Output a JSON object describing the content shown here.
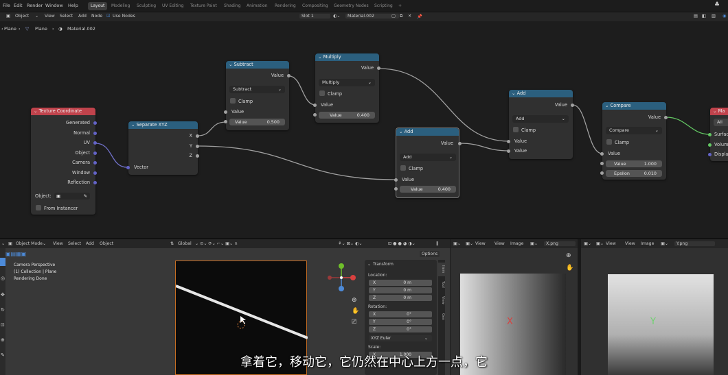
{
  "topbar": {
    "menus": [
      "File",
      "Edit",
      "Render",
      "Window",
      "Help"
    ],
    "tabs": [
      "Layout",
      "Modeling",
      "Sculpting",
      "UV Editing",
      "Texture Paint",
      "Shading",
      "Animation",
      "Rendering",
      "Compositing",
      "Geometry Nodes",
      "Scripting",
      "+"
    ]
  },
  "node_header": {
    "object_mode": "Object",
    "view": "View",
    "select": "Select",
    "add": "Add",
    "node": "Node",
    "use_nodes": "Use Nodes",
    "slot": "Slot 1",
    "material": "Material.002"
  },
  "breadcrumb": {
    "plane1": "Plane",
    "plane2": "Plane",
    "material": "Material.002"
  },
  "nodes": {
    "texcoord": {
      "title": "Texture Coordinate",
      "outputs": [
        "Generated",
        "Normal",
        "UV",
        "Object",
        "Camera",
        "Window",
        "Reflection"
      ],
      "object_label": "Object:",
      "from_instancer": "From Instancer"
    },
    "separate": {
      "title": "Separate XYZ",
      "x": "X",
      "y": "Y",
      "z": "Z",
      "vector": "Vector"
    },
    "subtract": {
      "title": "Subtract",
      "out": "Value",
      "op": "Subtract",
      "clamp": "Clamp",
      "in1": "Value",
      "in2_label": "Value",
      "in2_value": "0.500"
    },
    "multiply": {
      "title": "Multiply",
      "out": "Value",
      "op": "Multiply",
      "clamp": "Clamp",
      "in1": "Value",
      "in2_label": "Value",
      "in2_value": "0.400"
    },
    "add1": {
      "title": "Add",
      "out": "Value",
      "op": "Add",
      "clamp": "Clamp",
      "in1": "Value",
      "in2_label": "Value",
      "in2_value": "0.400"
    },
    "add2": {
      "title": "Add",
      "out": "Value",
      "op": "Add",
      "clamp": "Clamp",
      "in1": "Value",
      "in2": "Value"
    },
    "compare": {
      "title": "Compare",
      "out": "Value",
      "op": "Compare",
      "clamp": "Clamp",
      "in1": "Value",
      "in2_label": "Value",
      "in2_value": "1.000",
      "eps_label": "Epsilon",
      "eps_value": "0.010"
    },
    "output": {
      "title": "Ma",
      "target": "All",
      "surface": "Surfac",
      "volume": "Volum",
      "displacement": "Displa"
    }
  },
  "viewport": {
    "mode": "Object Mode",
    "view": "View",
    "select": "Select",
    "add": "Add",
    "object": "Object",
    "orientation": "Global",
    "options": "Options",
    "overlay": {
      "line1": "Camera Perspective",
      "line2": "(1) Collection | Plane",
      "line3": "Rendering Done"
    }
  },
  "npanel": {
    "title": "Transform",
    "location": "Location:",
    "loc": [
      {
        "axis": "X",
        "val": "0 m"
      },
      {
        "axis": "Y",
        "val": "0 m"
      },
      {
        "axis": "Z",
        "val": "0 m"
      }
    ],
    "rotation": "Rotation:",
    "rot": [
      {
        "axis": "X",
        "val": "0°"
      },
      {
        "axis": "Y",
        "val": "0°"
      },
      {
        "axis": "Z",
        "val": "0°"
      }
    ],
    "euler": "XYZ Euler",
    "scale": "Scale:",
    "scale_x": "1.000",
    "tabs": [
      "Item",
      "Tool",
      "View",
      "Gen"
    ]
  },
  "image_editors": [
    {
      "view": "View",
      "view2": "View",
      "image": "Image",
      "file": "X.png",
      "letter": "X",
      "letter_color": "#d9413f"
    },
    {
      "view": "View",
      "view2": "View",
      "image": "Image",
      "file": "Y.png",
      "letter": "Y",
      "letter_color": "#6fd16f"
    }
  ],
  "subtitle": "拿着它，移动它，它仍然在中心上方一点，它"
}
